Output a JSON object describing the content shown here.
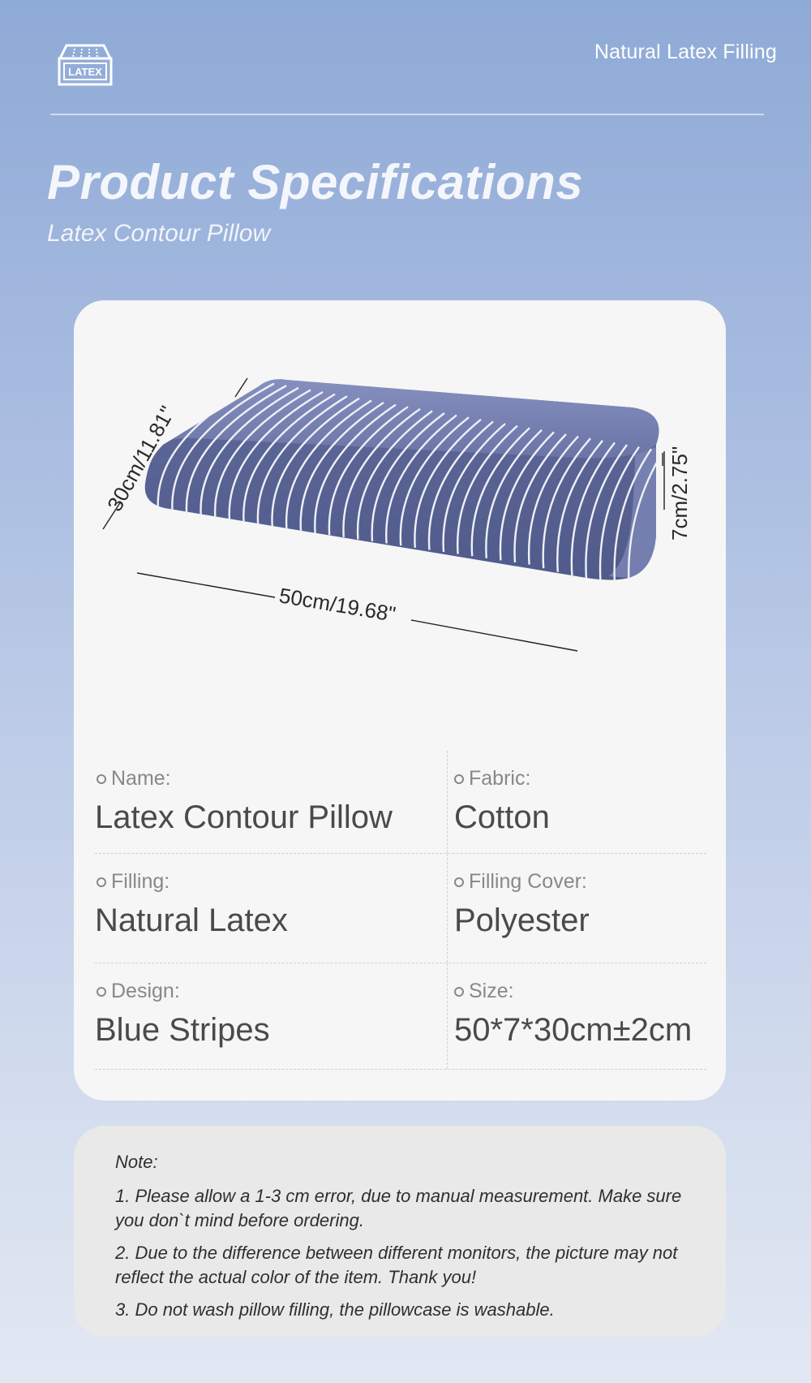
{
  "header": {
    "logo_text": "LATEX",
    "tagline": "Natural Latex Filling",
    "title": "Product Specifications",
    "subtitle": "Latex Contour Pillow"
  },
  "image": {
    "depth_label": "30cm/11.81\"",
    "width_label": "50cm/19.68\"",
    "height_label": "7cm/2.75\"",
    "pillow_color": "#6b76a8",
    "stripe_color": "#eef0f6"
  },
  "specs": [
    {
      "left": {
        "label": "Name:",
        "value": "Latex Contour Pillow"
      },
      "right": {
        "label": "Fabric:",
        "value": "Cotton"
      }
    },
    {
      "left": {
        "label": "Filling:",
        "value": "Natural Latex"
      },
      "right": {
        "label": "Filling Cover:",
        "value": "Polyester"
      }
    },
    {
      "left": {
        "label": "Design:",
        "value": "Blue Stripes"
      },
      "right": {
        "label": "Size:",
        "value": "50*7*30cm±2cm"
      }
    }
  ],
  "note": {
    "title": "Note:",
    "items": [
      "1. Please allow a 1-3 cm error, due to manual measurement. Make sure you don`t mind before ordering.",
      "2. Due to the difference between different monitors, the picture may not reflect the actual color of the item. Thank you!",
      "3. Do not wash pillow filling, the pillowcase is washable."
    ]
  }
}
